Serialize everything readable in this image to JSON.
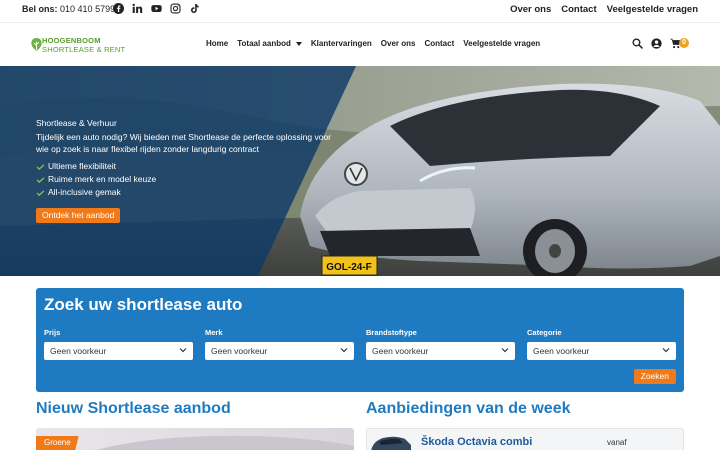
{
  "topbar": {
    "call_label": "Bel ons:",
    "phone": "010 410 5799",
    "social": [
      "facebook-icon",
      "linkedin-icon",
      "youtube-icon",
      "instagram-icon",
      "tiktok-icon"
    ],
    "links": [
      "Over ons",
      "Contact",
      "Veelgestelde vragen"
    ]
  },
  "logo": {
    "line1": "HOOGENBOOM",
    "line2": "SHORTLEASE & RENT"
  },
  "nav": {
    "items": [
      "Home",
      "Totaal aanbod",
      "Klantervaringen",
      "Over ons",
      "Contact",
      "Veelgestelde vragen"
    ],
    "cart_count": "0"
  },
  "hero": {
    "subtitle": "Shortlease & Verhuur",
    "description": "Tijdelijk een auto nodig? Wij bieden met Shortlease de perfecte oplossing voor wie op zoek is naar flexibel rijden zonder langdurig contract",
    "bullets": [
      "Ultieme flexibiliteit",
      "Ruime merk en model keuze",
      "All-inclusive gemak"
    ],
    "button": "Ontdek het aanbod",
    "plate": "GOL-24-F"
  },
  "search": {
    "title": "Zoek uw shortlease auto",
    "fields": [
      {
        "label": "Prijs",
        "value": "Geen voorkeur"
      },
      {
        "label": "Merk",
        "value": "Geen voorkeur"
      },
      {
        "label": "Brandstoftype",
        "value": "Geen voorkeur"
      },
      {
        "label": "Categorie",
        "value": "Geen voorkeur"
      }
    ],
    "button": "Zoeken"
  },
  "sections": {
    "new_title": "Nieuw Shortlease aanbod",
    "week_title": "Aanbiedingen van de week",
    "new_tag": "Groene",
    "offer_title": "Škoda Octavia combi",
    "offer_from": "vanaf"
  },
  "colors": {
    "brand_blue": "#1f7bc1",
    "accent_orange": "#f07a1a",
    "logo_green": "#5a9b2a",
    "check_green": "#7cc243"
  }
}
